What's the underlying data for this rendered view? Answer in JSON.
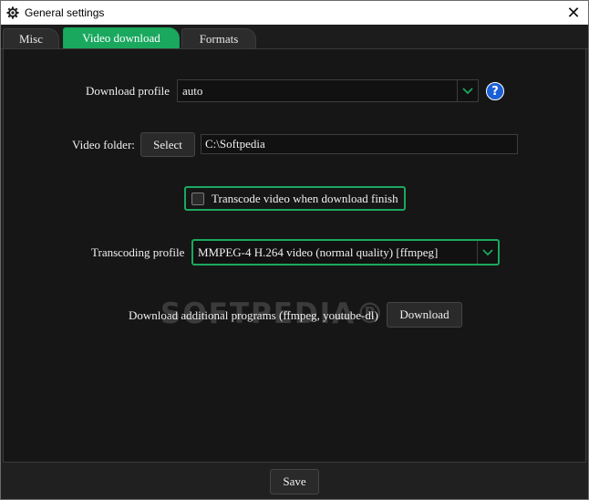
{
  "window": {
    "title": "General settings",
    "close_glyph": "✕"
  },
  "tabs": [
    {
      "label": "Misc",
      "active": false
    },
    {
      "label": "Video download",
      "active": true
    },
    {
      "label": "Formats",
      "active": false
    }
  ],
  "download_profile": {
    "label": "Download profile",
    "value": "auto",
    "help_glyph": "?"
  },
  "video_folder": {
    "label": "Video folder:",
    "button": "Select",
    "value": "C:\\Softpedia"
  },
  "transcode": {
    "label": "Transcode video when download finish",
    "checked": false
  },
  "transcoding_profile": {
    "label": "Transcoding profile",
    "value": "MMPEG-4 H.264 video (normal quality) [ffmpeg]"
  },
  "additional": {
    "label": "Download additional programs (ffmpeg, youtube-dl)",
    "button": "Download"
  },
  "watermark": "SOFTPEDIA®",
  "footer": {
    "save": "Save"
  },
  "colors": {
    "accent": "#1aa85e",
    "background": "#161616",
    "help": "#1a5fd6"
  },
  "icons": {
    "title": "gear-icon",
    "dropdown": "chevron-down-icon",
    "help": "help-icon",
    "close": "close-icon"
  }
}
